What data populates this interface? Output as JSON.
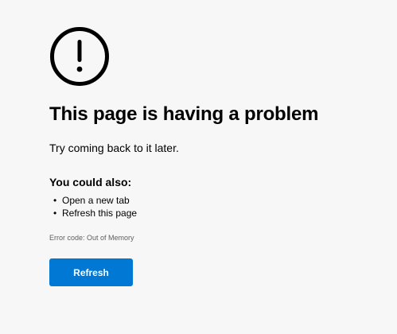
{
  "error": {
    "icon": "exclamation-circle-icon",
    "title": "This page is having a problem",
    "subtitle": "Try coming back to it later.",
    "also_heading": "You could also:",
    "suggestions": [
      {
        "bullet": "•",
        "label": "Open a new tab"
      },
      {
        "bullet": "•",
        "label": "Refresh this page"
      }
    ],
    "error_code": "Error code: Out of Memory",
    "refresh_label": "Refresh"
  },
  "colors": {
    "background": "#f7f7f7",
    "text": "#000000",
    "button": "#0078d4",
    "button_text": "#ffffff",
    "secondary_text": "#5f5f5f"
  }
}
